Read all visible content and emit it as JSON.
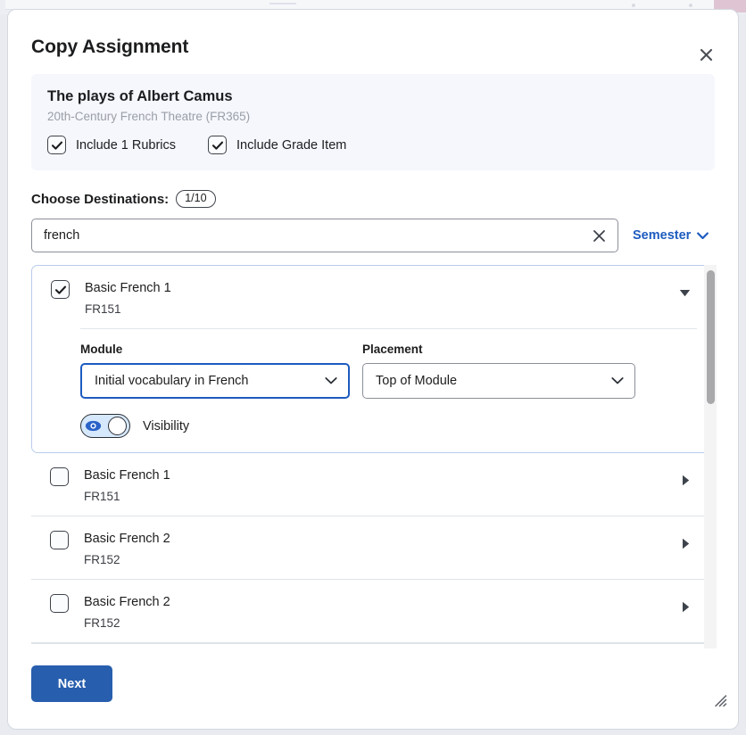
{
  "dialog": {
    "title": "Copy Assignment",
    "close_label": "close-icon"
  },
  "source": {
    "title": "The plays of Albert Camus",
    "subtitle": "20th-Century French Theatre (FR365)",
    "options": [
      {
        "label": "Include 1 Rubrics",
        "checked": true
      },
      {
        "label": "Include Grade Item",
        "checked": true
      }
    ]
  },
  "destinations": {
    "label": "Choose Destinations:",
    "count": "1/10",
    "search": {
      "value": "french",
      "placeholder": "",
      "clear_label": "clear-icon"
    },
    "filter": {
      "label": "Semester"
    },
    "items": [
      {
        "name": "Basic French 1",
        "code": "FR151",
        "checked": true,
        "expanded": true,
        "module": {
          "label": "Module",
          "value": "Initial vocabulary in French"
        },
        "placement": {
          "label": "Placement",
          "value": "Top of Module"
        },
        "visibility": {
          "label": "Visibility",
          "on": true
        }
      },
      {
        "name": "Basic French 1",
        "code": "FR151",
        "checked": false,
        "expanded": false
      },
      {
        "name": "Basic French 2",
        "code": "FR152",
        "checked": false,
        "expanded": false
      },
      {
        "name": "Basic French 2",
        "code": "FR152",
        "checked": false,
        "expanded": false
      }
    ]
  },
  "footer": {
    "next_label": "Next"
  },
  "colors": {
    "accent": "#1d5bbf",
    "button": "#275ead",
    "card_bg": "#f5f7fd",
    "selected_border": "#b9ccec"
  }
}
